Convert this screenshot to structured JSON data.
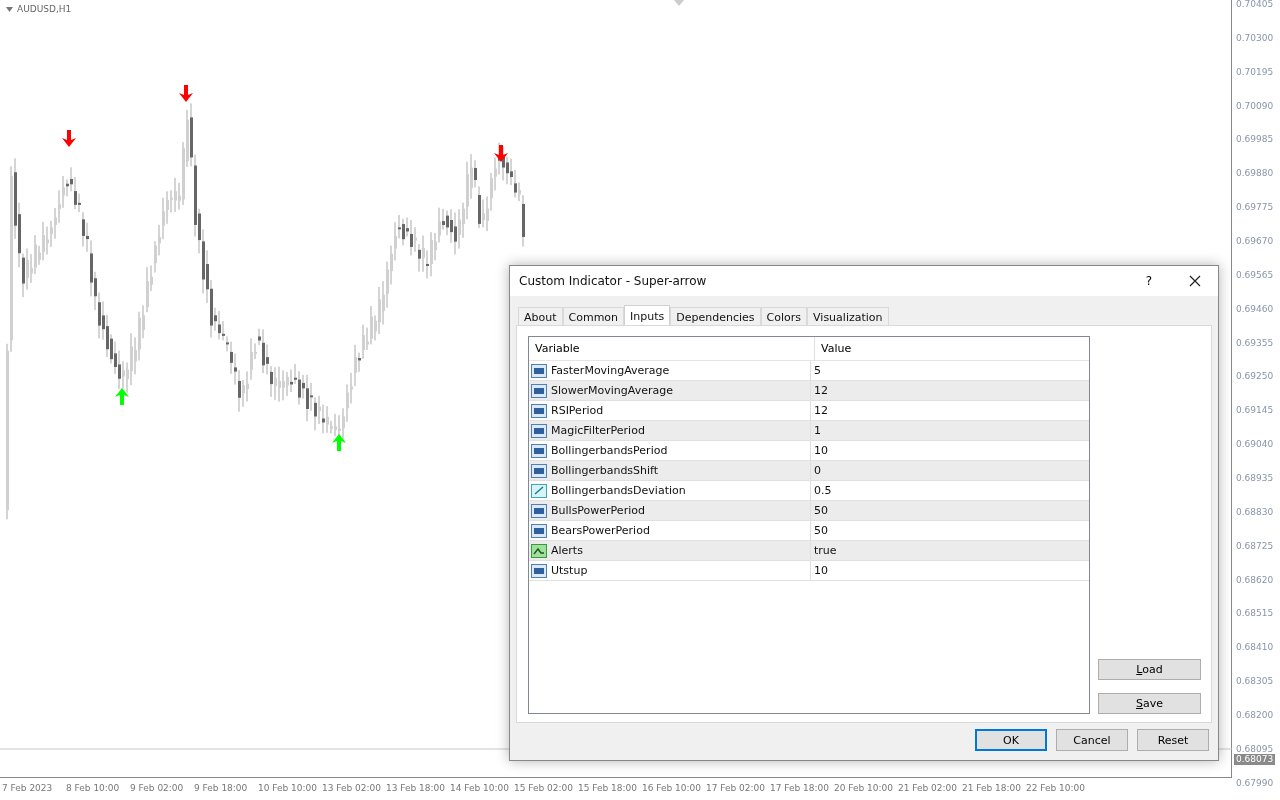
{
  "chart": {
    "symbol": "AUDUSD,H1",
    "price_axis": [
      "0.70405",
      "0.70300",
      "0.70195",
      "0.70090",
      "0.69985",
      "0.69880",
      "0.69775",
      "0.69670",
      "0.69565",
      "0.69460",
      "0.69355",
      "0.69250",
      "0.69145",
      "0.69040",
      "0.68935",
      "0.68830",
      "0.68725",
      "0.68620",
      "0.68515",
      "0.68410",
      "0.68305",
      "0.68200",
      "0.68095",
      "0.67990"
    ],
    "current_price": "0.68073",
    "time_axis": [
      "7 Feb 2023",
      "8 Feb 10:00",
      "9 Feb 02:00",
      "9 Feb 18:00",
      "10 Feb 10:00",
      "13 Feb 02:00",
      "13 Feb 18:00",
      "14 Feb 10:00",
      "15 Feb 02:00",
      "15 Feb 18:00",
      "16 Feb 10:00",
      "17 Feb 02:00",
      "17 Feb 18:00",
      "20 Feb 10:00",
      "21 Feb 02:00",
      "21 Feb 18:00",
      "22 Feb 10:00"
    ]
  },
  "dialog": {
    "title": "Custom Indicator - Super-arrow",
    "help": "?",
    "tabs": [
      {
        "label": "About",
        "selected": false
      },
      {
        "label": "Common",
        "selected": false
      },
      {
        "label": "Inputs",
        "selected": true
      },
      {
        "label": "Dependencies",
        "selected": false
      },
      {
        "label": "Colors",
        "selected": false
      },
      {
        "label": "Visualization",
        "selected": false
      }
    ],
    "columns": [
      "Variable",
      "Value"
    ],
    "rows": [
      {
        "kind": "integer",
        "variable": "FasterMovingAverage",
        "value": "5"
      },
      {
        "kind": "integer",
        "variable": "SlowerMovingAverage",
        "value": "12"
      },
      {
        "kind": "integer",
        "variable": "RSIPeriod",
        "value": "12"
      },
      {
        "kind": "integer",
        "variable": "MagicFilterPeriod",
        "value": "1"
      },
      {
        "kind": "integer",
        "variable": "BollingerbandsPeriod",
        "value": "10"
      },
      {
        "kind": "integer",
        "variable": "BollingerbandsShift",
        "value": "0"
      },
      {
        "kind": "double",
        "variable": "BollingerbandsDeviation",
        "value": "0.5"
      },
      {
        "kind": "integer",
        "variable": "BullsPowerPeriod",
        "value": "50"
      },
      {
        "kind": "integer",
        "variable": "BearsPowerPeriod",
        "value": "50"
      },
      {
        "kind": "bool",
        "variable": "Alerts",
        "value": "true"
      },
      {
        "kind": "integer",
        "variable": "Utstup",
        "value": "10"
      }
    ],
    "side_buttons": [
      {
        "label": "Load",
        "mnemonic": true
      },
      {
        "label": "Save",
        "mnemonic": true
      }
    ],
    "buttons": [
      {
        "label": "OK",
        "default": true
      },
      {
        "label": "Cancel",
        "default": false
      },
      {
        "label": "Reset",
        "default": false
      }
    ]
  }
}
